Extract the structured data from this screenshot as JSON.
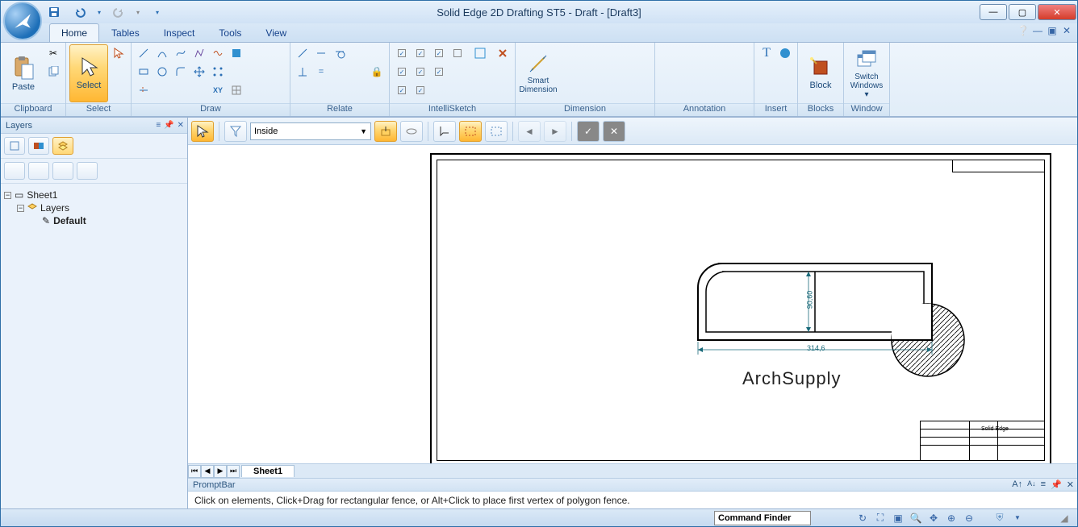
{
  "title": "Solid Edge 2D Drafting ST5 - Draft - [Draft3]",
  "qat": {
    "save": "save-icon",
    "undo": "undo-icon",
    "redo": "redo-icon"
  },
  "tabs": [
    "Home",
    "Tables",
    "Inspect",
    "Tools",
    "View"
  ],
  "active_tab": "Home",
  "ribbon": {
    "groups": [
      {
        "id": "clipboard",
        "label": "Clipboard",
        "big": {
          "label": "Paste",
          "icon": "clipboard-icon"
        }
      },
      {
        "id": "select",
        "label": "Select",
        "big": {
          "label": "Select",
          "icon": "arrow-cursor-icon",
          "active": true
        }
      },
      {
        "id": "draw",
        "label": "Draw",
        "cols": 6
      },
      {
        "id": "relate",
        "label": "Relate",
        "cols": 5
      },
      {
        "id": "intellisketch",
        "label": "IntelliSketch",
        "cols": 6
      },
      {
        "id": "dimension",
        "label": "Dimension",
        "big": {
          "label": "Smart\nDimension",
          "icon": "smart-dim-icon"
        },
        "cols": 5
      },
      {
        "id": "annotation",
        "label": "Annotation",
        "cols": 5
      },
      {
        "id": "insert",
        "label": "Insert",
        "cols": 2
      },
      {
        "id": "blocks",
        "label": "Blocks",
        "big": {
          "label": "Block",
          "icon": "block-icon"
        }
      },
      {
        "id": "window",
        "label": "Window",
        "big": {
          "label": "Switch\nWindows",
          "icon": "windows-icon",
          "dropdown": true
        }
      }
    ]
  },
  "layers_panel": {
    "title": "Layers",
    "tree": [
      {
        "label": "Sheet1",
        "level": 0,
        "expanded": true,
        "icon": "sheet-icon"
      },
      {
        "label": "Layers",
        "level": 1,
        "expanded": true,
        "icon": "layers-icon"
      },
      {
        "label": "Default",
        "level": 2,
        "bold": true,
        "icon": "pencil-icon"
      }
    ]
  },
  "cmdbar": {
    "select_mode": "Inside"
  },
  "canvas": {
    "watermark": "ArchSupply",
    "dim_horizontal": "314,6",
    "dim_vertical": "90,60",
    "titleblock_text": "Solid Edge"
  },
  "sheet_tab": "Sheet1",
  "promptbar": {
    "title": "PromptBar",
    "text": "Click on elements, Click+Drag for rectangular fence, or Alt+Click to place first vertex of polygon fence."
  },
  "command_finder_label": "Command Finder"
}
